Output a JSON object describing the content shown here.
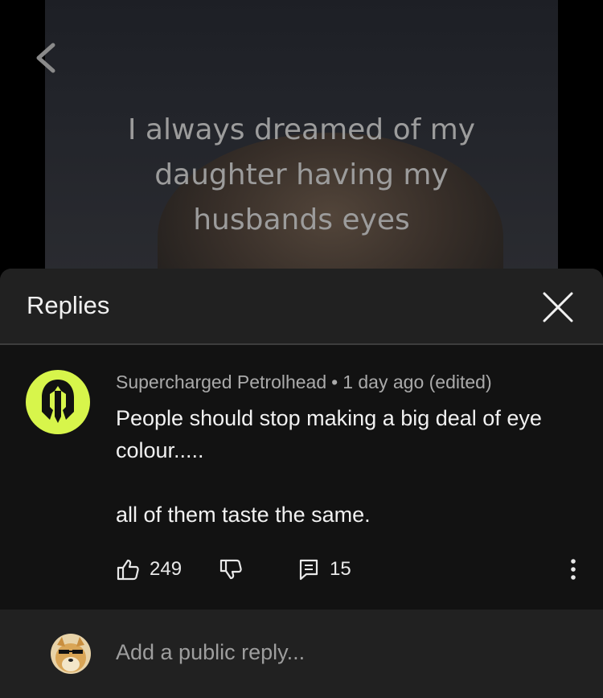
{
  "video": {
    "caption_lines": [
      "I always dreamed of my",
      "daughter having my",
      "husbands eyes"
    ]
  },
  "sheet": {
    "title": "Replies"
  },
  "comment": {
    "author": "Supercharged Petrolhead",
    "separator": "•",
    "timestamp": "1 day ago (edited)",
    "text_line_1": "People should stop making a big deal of eye colour.....",
    "text_line_2": "all of them taste the same.",
    "like_count": "249",
    "reply_count": "15"
  },
  "reply_box": {
    "placeholder": "Add a public reply..."
  },
  "icons": {
    "back": "chevron-left-icon",
    "close": "close-icon",
    "like": "thumbs-up-icon",
    "dislike": "thumbs-down-icon",
    "reply": "comment-icon",
    "more": "more-vertical-icon"
  },
  "colors": {
    "avatar_accent": "#d7f54b",
    "sheet_bg": "#121212",
    "header_bg": "#212121"
  }
}
